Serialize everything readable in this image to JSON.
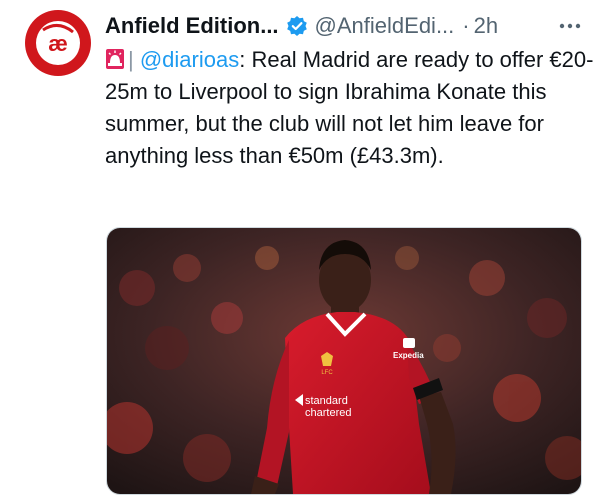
{
  "author": {
    "name": "Anfield Edition...",
    "handle": "@AnfieldEdi...",
    "dot": "·",
    "time": "2h",
    "avatar_text": "æ",
    "avatar_color": "#d0171c"
  },
  "tweet": {
    "separator": "| ",
    "mention": "@diarioas",
    "body": ": Real Madrid are ready to offer €20-25m to Liverpool to sign Ibrahima Konate this summer, but the club will not let him leave for anything less than €50m (£43.3m)."
  },
  "media": {
    "sponsor_line1": "standard",
    "sponsor_line2": "chartered",
    "sleeve_text": "Expedia",
    "crest_text": "LFC"
  },
  "colors": {
    "verified": "#1d9bf0",
    "link": "#1d9bf0",
    "secondary": "#536471",
    "kit_red": "#c8102e"
  },
  "icons": [
    "siren-icon",
    "verified-icon",
    "more-icon"
  ]
}
